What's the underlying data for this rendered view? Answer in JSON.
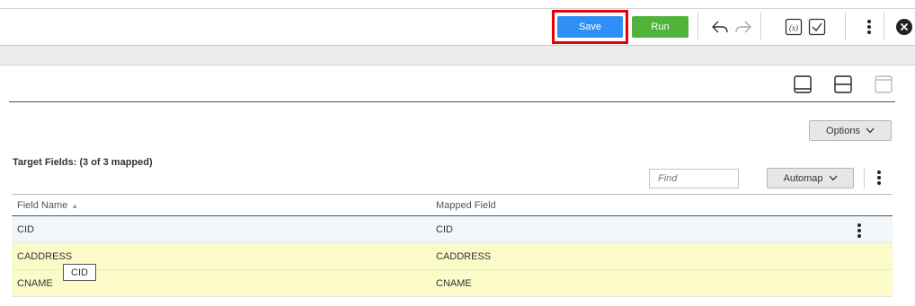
{
  "toolbar": {
    "save_label": "Save",
    "run_label": "Run",
    "icons": [
      "undo-icon",
      "redo-icon",
      "expression-icon",
      "validate-icon",
      "more-icon",
      "close-icon"
    ],
    "colors": {
      "save": "#2f8ff4",
      "run": "#52b33a",
      "highlight": "#e60000"
    }
  },
  "layout_icons": [
    "layout-bottom-icon",
    "layout-split-icon",
    "layout-top-icon"
  ],
  "options": {
    "label": "Options"
  },
  "target": {
    "title": "Target Fields: (3 of 3 mapped)",
    "find_placeholder": "Find",
    "automap_label": "Automap"
  },
  "table": {
    "headers": {
      "field_name": "Field Name",
      "mapped_field": "Mapped Field"
    },
    "rows": [
      {
        "field": "CID",
        "mapped": "CID"
      },
      {
        "field": "CADDRESS",
        "mapped": "CADDRESS"
      },
      {
        "field": "CNAME",
        "mapped": "CNAME"
      }
    ]
  },
  "tooltip": {
    "text": "CID"
  }
}
